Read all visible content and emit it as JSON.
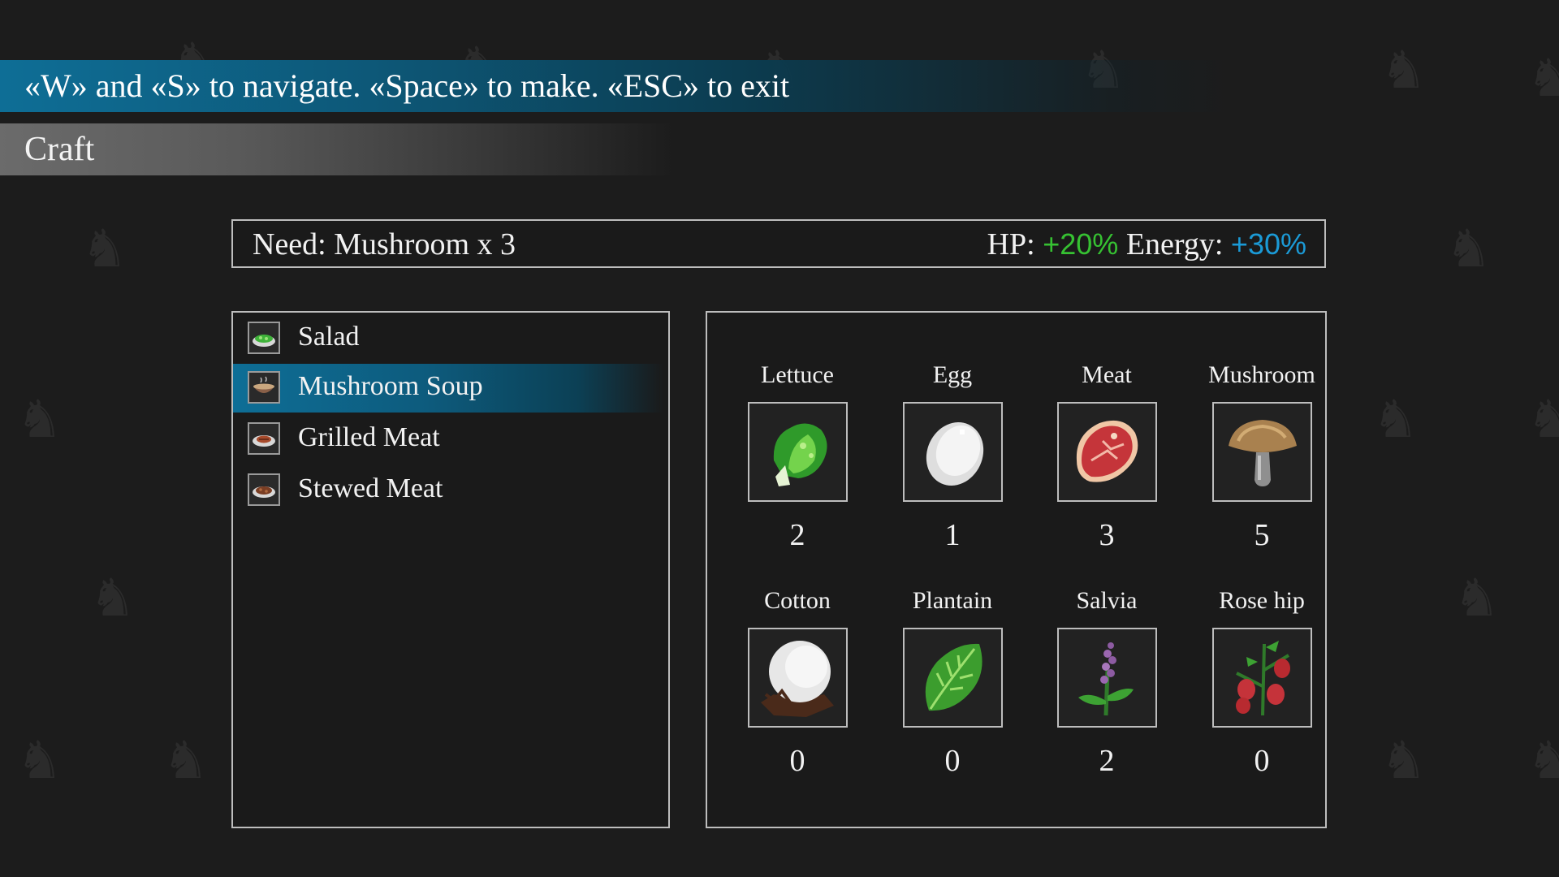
{
  "hint": "«W» and «S» to navigate. «Space» to make. «ESC» to exit",
  "title": "Craft",
  "need": {
    "text": "Need: Mushroom x 3",
    "hp_label": "HP:",
    "hp_value": "+20%",
    "energy_label": "Energy:",
    "energy_value": "+30%"
  },
  "colors": {
    "accent": "#0e6e96",
    "hp": "#36c132",
    "energy": "#1b9ad6"
  },
  "recipes": [
    {
      "label": "Salad",
      "icon": "salad-bowl-icon",
      "selected": false
    },
    {
      "label": "Mushroom Soup",
      "icon": "soup-bowl-icon",
      "selected": true
    },
    {
      "label": "Grilled Meat",
      "icon": "grilled-meat-plate-icon",
      "selected": false
    },
    {
      "label": "Stewed Meat",
      "icon": "stewed-meat-plate-icon",
      "selected": false
    }
  ],
  "ingredients": [
    {
      "name": "Lettuce",
      "count": "2",
      "icon": "lettuce-icon"
    },
    {
      "name": "Egg",
      "count": "1",
      "icon": "egg-icon"
    },
    {
      "name": "Meat",
      "count": "3",
      "icon": "meat-icon"
    },
    {
      "name": "Mushroom",
      "count": "5",
      "icon": "mushroom-icon"
    },
    {
      "name": "Cotton",
      "count": "0",
      "icon": "cotton-icon"
    },
    {
      "name": "Plantain",
      "count": "0",
      "icon": "plantain-leaf-icon"
    },
    {
      "name": "Salvia",
      "count": "2",
      "icon": "salvia-icon"
    },
    {
      "name": "Rose hip",
      "count": "0",
      "icon": "rose-hip-icon"
    }
  ]
}
